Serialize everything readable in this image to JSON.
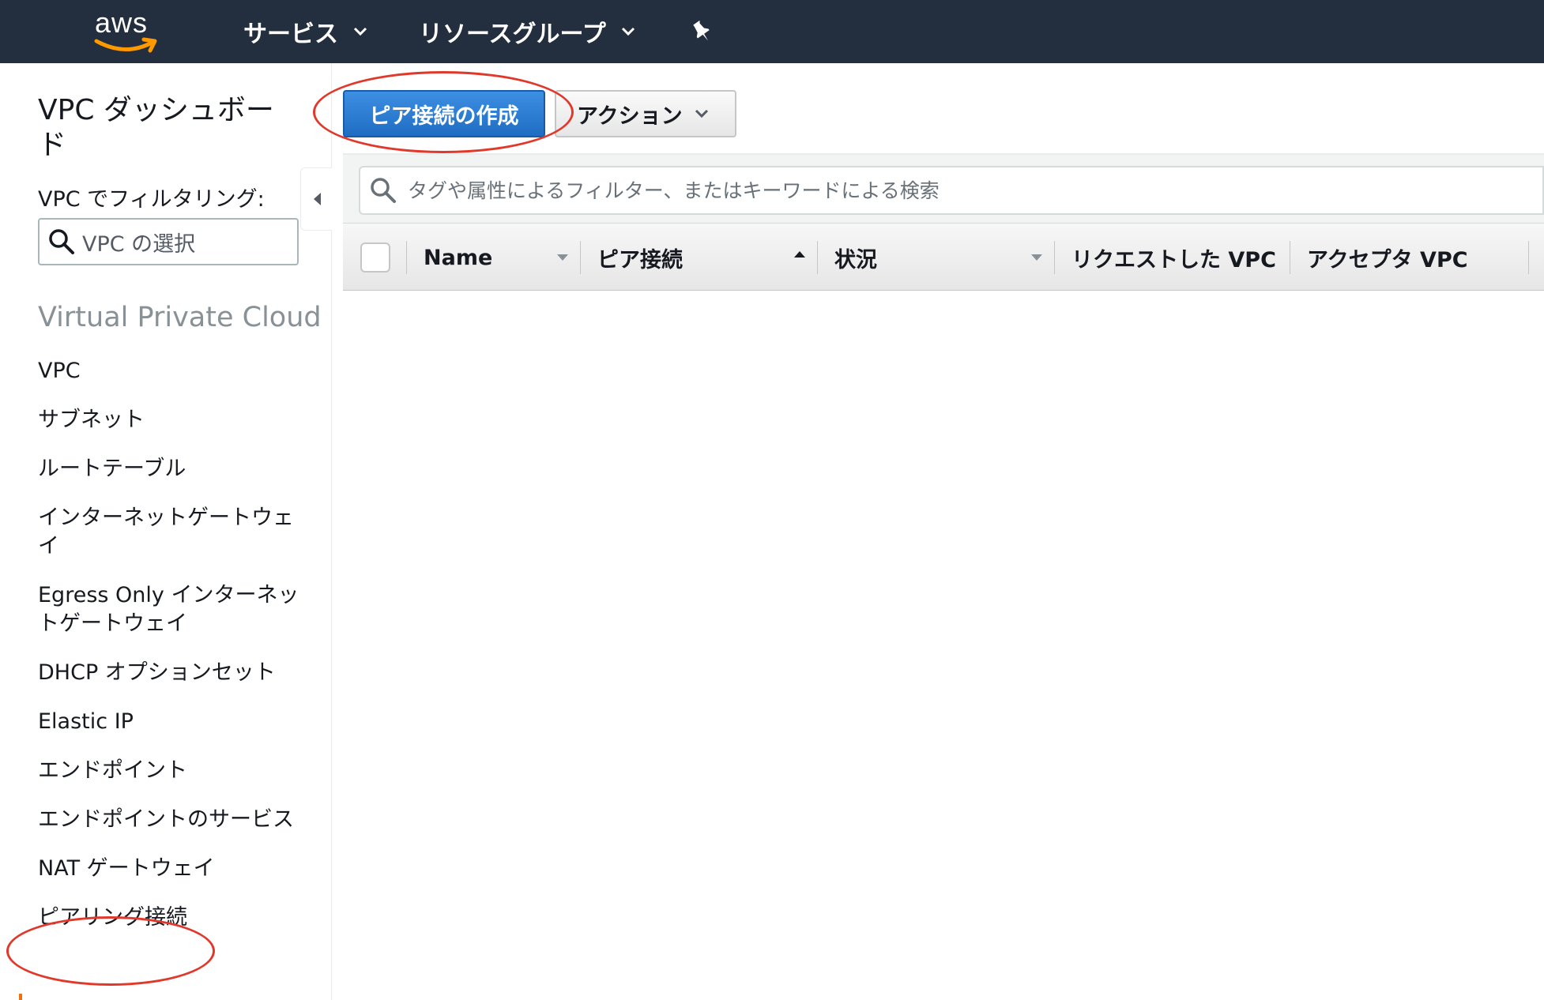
{
  "topbar": {
    "logo_text": "aws",
    "services_label": "サービス",
    "resource_groups_label": "リソースグループ",
    "icons": {
      "dropdown": "chevron-down-icon",
      "pin": "pin-icon"
    },
    "colors": {
      "background": "#232f3e",
      "logo_smile": "#ff9900"
    }
  },
  "sidebar": {
    "dashboard_title": "VPC ダッシュボード",
    "filter_label": "VPC でフィルタリング:",
    "vpc_select_placeholder": "VPC の選択",
    "section_heading": "Virtual Private Cloud",
    "items": [
      {
        "label": "VPC"
      },
      {
        "label": "サブネット"
      },
      {
        "label": "ルートテーブル"
      },
      {
        "label": "インターネットゲートウェイ"
      },
      {
        "label": "Egress Only インターネットゲートウェイ"
      },
      {
        "label": "DHCP オプションセット"
      },
      {
        "label": "Elastic IP"
      },
      {
        "label": "エンドポイント"
      },
      {
        "label": "エンドポイントのサービス"
      },
      {
        "label": "NAT ゲートウェイ"
      },
      {
        "label": "ピアリング接続",
        "active": true
      }
    ],
    "colors": {
      "active_indicator": "#ec7211"
    }
  },
  "toolbar": {
    "create_label": "ピア接続の作成",
    "actions_label": "アクション",
    "colors": {
      "primary": "#1f6dc3"
    }
  },
  "search": {
    "placeholder": "タグや属性によるフィルター、またはキーワードによる検索"
  },
  "table": {
    "columns": [
      {
        "label": "Name",
        "sort": "none"
      },
      {
        "label": "ピア接続",
        "sort": "ascending"
      },
      {
        "label": "状況",
        "sort": "none"
      },
      {
        "label": "リクエストした VPC"
      },
      {
        "label": "アクセプタ VPC"
      }
    ],
    "rows": []
  },
  "annotations": {
    "color": "#e0392b"
  }
}
